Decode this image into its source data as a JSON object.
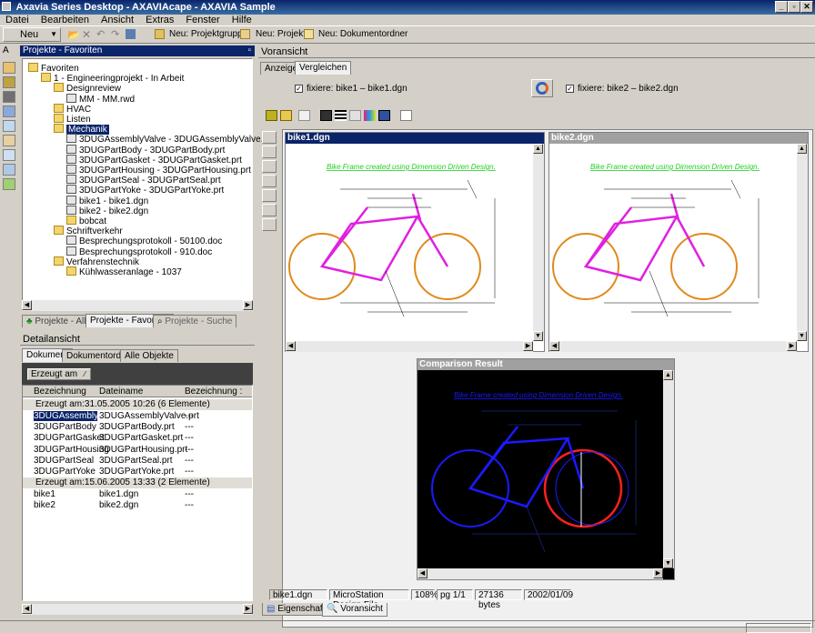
{
  "window": {
    "title": "Axavia Series Desktop - AXAVIAcape - AXAVIA Sample"
  },
  "menu": [
    "Datei",
    "Bearbeiten",
    "Ansicht",
    "Extras",
    "Fenster",
    "Hilfe"
  ],
  "toolbar": {
    "new_label": "Neu",
    "new_projectgroup": "Neu: Projektgruppe",
    "new_project": "Neu: Projekt",
    "new_docfolder": "Neu: Dokumentordner"
  },
  "left_panel": {
    "title": "Projekte - Favoriten",
    "tree": [
      {
        "label": "Favoriten",
        "indent": 0,
        "icon": "fold"
      },
      {
        "label": "1 - Engineeringprojekt - In Arbeit",
        "indent": 1,
        "icon": "fold"
      },
      {
        "label": "Designreview",
        "indent": 2,
        "icon": "fold"
      },
      {
        "label": "MM - MM.rwd",
        "indent": 3,
        "icon": "file"
      },
      {
        "label": "HVAC",
        "indent": 2,
        "icon": "fold"
      },
      {
        "label": "Listen",
        "indent": 2,
        "icon": "fold"
      },
      {
        "label": "Mechanik",
        "indent": 2,
        "icon": "fold",
        "selected": true
      },
      {
        "label": "3DUGAssemblyValve - 3DUGAssemblyValve.prt",
        "indent": 3,
        "icon": "file"
      },
      {
        "label": "3DUGPartBody - 3DUGPartBody.prt",
        "indent": 3,
        "icon": "file"
      },
      {
        "label": "3DUGPartGasket - 3DUGPartGasket.prt",
        "indent": 3,
        "icon": "file"
      },
      {
        "label": "3DUGPartHousing - 3DUGPartHousing.prt",
        "indent": 3,
        "icon": "file"
      },
      {
        "label": "3DUGPartSeal - 3DUGPartSeal.prt",
        "indent": 3,
        "icon": "file"
      },
      {
        "label": "3DUGPartYoke - 3DUGPartYoke.prt",
        "indent": 3,
        "icon": "file"
      },
      {
        "label": "bike1 - bike1.dgn",
        "indent": 3,
        "icon": "file"
      },
      {
        "label": "bike2 - bike2.dgn",
        "indent": 3,
        "icon": "file"
      },
      {
        "label": "bobcat",
        "indent": 3,
        "icon": "fold"
      },
      {
        "label": "Schriftverkehr",
        "indent": 2,
        "icon": "fold"
      },
      {
        "label": "Besprechungsprotokoll - 50100.doc",
        "indent": 3,
        "icon": "file"
      },
      {
        "label": "Besprechungsprotokoll - 910.doc",
        "indent": 3,
        "icon": "file"
      },
      {
        "label": "Verfahrenstechnik",
        "indent": 2,
        "icon": "fold"
      },
      {
        "label": "Kühlwasseranlage - 1037",
        "indent": 3,
        "icon": "fold"
      }
    ],
    "tabs": [
      "Projekte - Alle",
      "Projekte - Favoriten",
      "Projekte - Suche"
    ]
  },
  "detail": {
    "title": "Detailansicht",
    "tabs": [
      "Dokument",
      "Dokumentordner",
      "Alle Objekte"
    ],
    "group_by": "Erzeugt am",
    "columns": [
      "Bezeichnung",
      "Dateiname",
      "Bezeichnung :"
    ],
    "groups": [
      {
        "label": "Erzeugt am:31.05.2005 10:26 (6 Elemente)",
        "rows": [
          [
            "3DUGAssemblyValve",
            "3DUGAssemblyValve.prt",
            "---"
          ],
          [
            "3DUGPartBody",
            "3DUGPartBody.prt",
            "---"
          ],
          [
            "3DUGPartGasket",
            "3DUGPartGasket.prt",
            "---"
          ],
          [
            "3DUGPartHousing",
            "3DUGPartHousing.prt",
            "---"
          ],
          [
            "3DUGPartSeal",
            "3DUGPartSeal.prt",
            "---"
          ],
          [
            "3DUGPartYoke",
            "3DUGPartYoke.prt",
            "---"
          ]
        ]
      },
      {
        "label": "Erzeugt am:15.06.2005 13:33 (2 Elemente)",
        "rows": [
          [
            "bike1",
            "bike1.dgn",
            "---"
          ],
          [
            "bike2",
            "bike2.dgn",
            "---"
          ]
        ]
      }
    ]
  },
  "preview": {
    "title": "Voransicht",
    "tabs": [
      "Anzeigen",
      "Vergleichen"
    ],
    "fix1": "fixiere: bike1 – bike1.dgn",
    "fix2": "fixiere: bike2 – bike2.dgn",
    "view1_title": "bike1.dgn",
    "view2_title": "bike2.dgn",
    "compare_title": "Comparison Result",
    "drawing_caption": "Bike Frame created using Dimension Driven Design.",
    "status": [
      "bike1.dgn",
      "MicroStation Design File",
      "108%",
      "pg 1/1",
      "27136 bytes",
      "2002/01/09"
    ],
    "bottom_tabs": [
      "Eigenschaften",
      "Voransicht"
    ]
  },
  "colors": {
    "titlebar": "#0a246a",
    "wheel_orange": "#e08a1c",
    "frame_magenta": "#e020e0",
    "compare_blue": "#1a1aff",
    "compare_red": "#ff2020",
    "caption_green": "#20d020"
  },
  "left_strip": {
    "label": "A"
  }
}
